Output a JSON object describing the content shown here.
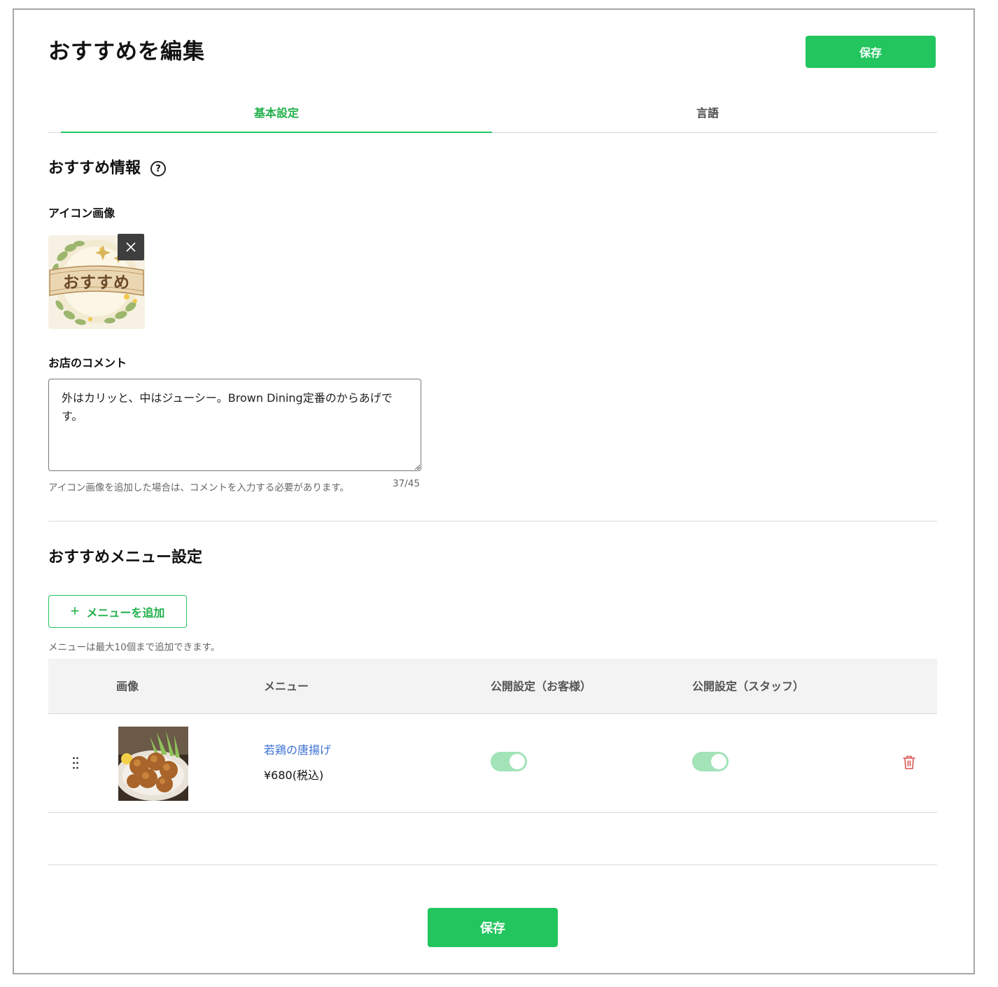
{
  "header": {
    "title": "おすすめを編集",
    "save_label": "保存"
  },
  "tabs": [
    {
      "label": "基本設定",
      "active": true
    },
    {
      "label": "言語",
      "active": false
    }
  ],
  "info_section": {
    "title": "おすすめ情報",
    "help_symbol": "?",
    "icon_label": "アイコン画像",
    "icon_image_text": "おすすめ",
    "comment_label": "お店のコメント",
    "comment_value": "外はカリッと、中はジューシー。Brown Dining定番のからあげです。",
    "comment_helper": "アイコン画像を追加した場合は、コメントを入力する必要があります。",
    "comment_counter": "37/45"
  },
  "menu_section": {
    "title": "おすすめメニュー設定",
    "add_button_label": "メニューを追加",
    "limit_note": "メニューは最大10個まで追加できます。",
    "columns": [
      "画像",
      "メニュー",
      "公開設定（お客様）",
      "公開設定（スタッフ）"
    ],
    "rows": [
      {
        "name": "若鶏の唐揚げ",
        "price": "¥680(税込)",
        "public_customer": true,
        "public_staff": true
      }
    ]
  },
  "footer": {
    "save_label": "保存"
  },
  "colors": {
    "accent": "#22c55e",
    "tab_active": "#22b14c",
    "link": "#3b6fd3",
    "toggle_on": "#a2e3b8",
    "delete": "#d9534f"
  }
}
